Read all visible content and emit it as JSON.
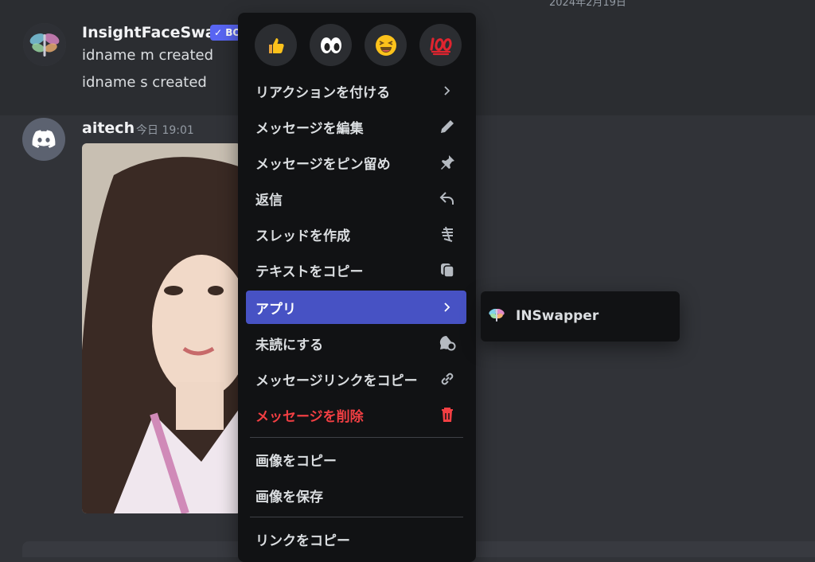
{
  "date_divider": "2024年2月19日",
  "messages": [
    {
      "username": "InsightFaceSwap",
      "tag": "✓ BOT",
      "lines": [
        "idname m created",
        "idname s created"
      ]
    },
    {
      "username": "aitech",
      "timestamp": "今日 19:01"
    }
  ],
  "reactions": [
    "thumbs-up",
    "eyes",
    "laughing",
    "hundred-points"
  ],
  "menu": {
    "items": [
      {
        "label": "リアクションを付ける",
        "icon": "chevron-right-icon"
      },
      {
        "label": "メッセージを編集",
        "icon": "pencil-icon"
      },
      {
        "label": "メッセージをピン留め",
        "icon": "pin-icon"
      },
      {
        "label": "返信",
        "icon": "reply-icon"
      },
      {
        "label": "スレッドを作成",
        "icon": "thread-icon"
      },
      {
        "label": "テキストをコピー",
        "icon": "copy-text-icon"
      },
      {
        "label": "アプリ",
        "icon": "chevron-right-icon"
      },
      {
        "label": "未読にする",
        "icon": "mark-unread-icon"
      },
      {
        "label": "メッセージリンクをコピー",
        "icon": "link-icon"
      },
      {
        "label": "メッセージを削除",
        "icon": "trash-icon"
      },
      {
        "label": "画像をコピー"
      },
      {
        "label": "画像を保存"
      },
      {
        "label": "リンクをコピー"
      }
    ]
  },
  "submenu": {
    "items": [
      {
        "label": "INSwapper"
      }
    ]
  },
  "colors": {
    "accent": "#4752c4",
    "danger": "#f23f43",
    "bot_tag": "#5865f2"
  }
}
